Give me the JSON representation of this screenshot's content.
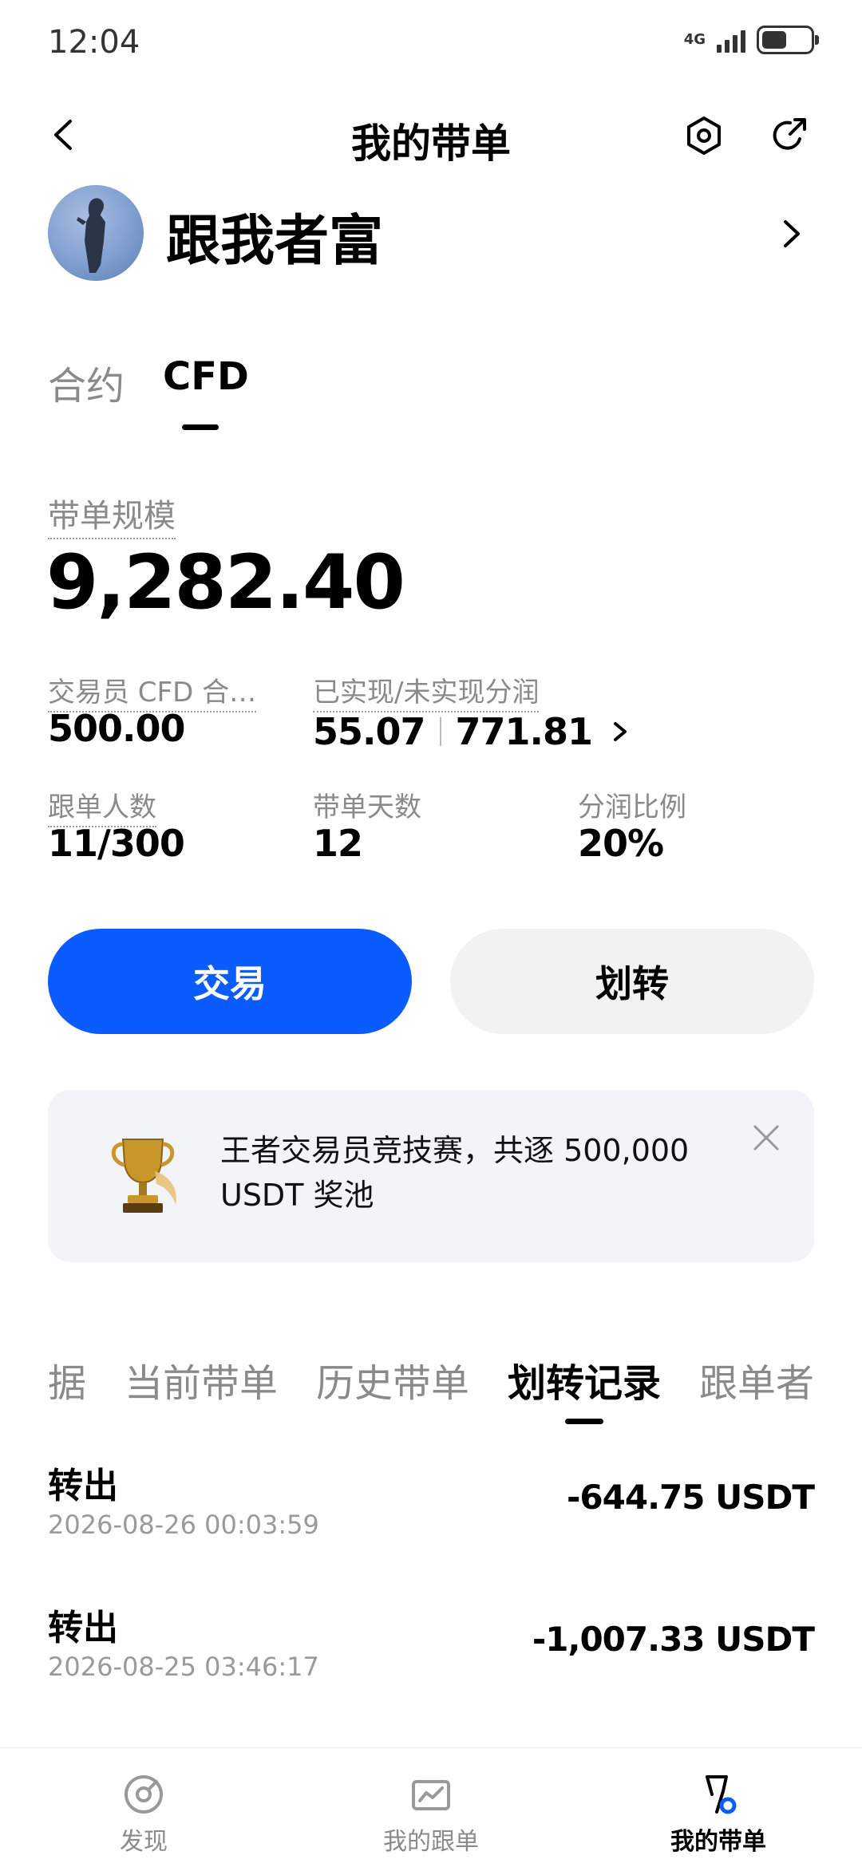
{
  "status_bar": {
    "time": "12:04",
    "network": "4G"
  },
  "nav": {
    "title": "我的带单"
  },
  "profile": {
    "name": "跟我者富"
  },
  "product_tabs": [
    {
      "label": "合约",
      "active": false
    },
    {
      "label": "CFD",
      "active": true
    }
  ],
  "stats": {
    "scale_label": "带单规模",
    "scale_value": "9,282.40",
    "trader_cfd_label": "交易员 CFD 合…",
    "trader_cfd_value": "500.00",
    "pnl_label": "已实现/未实现分润",
    "realized": "55.07",
    "unrealized": "771.81",
    "followers_label": "跟单人数",
    "followers_value": "11/300",
    "days_label": "带单天数",
    "days_value": "12",
    "share_label": "分润比例",
    "share_value": "20%"
  },
  "actions": {
    "trade_label": "交易",
    "transfer_label": "划转"
  },
  "banner": {
    "text": "王者交易员竞技赛，共逐 500,000 USDT 奖池"
  },
  "record_tabs": [
    {
      "label": "据",
      "active": false
    },
    {
      "label": "当前带单",
      "active": false
    },
    {
      "label": "历史带单",
      "active": false
    },
    {
      "label": "划转记录",
      "active": true
    },
    {
      "label": "跟单者",
      "active": false
    }
  ],
  "records": [
    {
      "type": "转出",
      "time": "2026-08-26 00:03:59",
      "amount": "-644.75 USDT"
    },
    {
      "type": "转出",
      "time": "2026-08-25 03:46:17",
      "amount": "-1,007.33 USDT"
    }
  ],
  "bottom_nav": [
    {
      "label": "发现",
      "icon": "discover-icon",
      "active": false
    },
    {
      "label": "我的跟单",
      "icon": "chart-icon",
      "active": false
    },
    {
      "label": "我的带单",
      "icon": "lead-trade-icon",
      "active": true
    }
  ],
  "colors": {
    "primary": "#0a5cff",
    "muted": "#8a8a8a",
    "surface": "#f2f2f2"
  }
}
